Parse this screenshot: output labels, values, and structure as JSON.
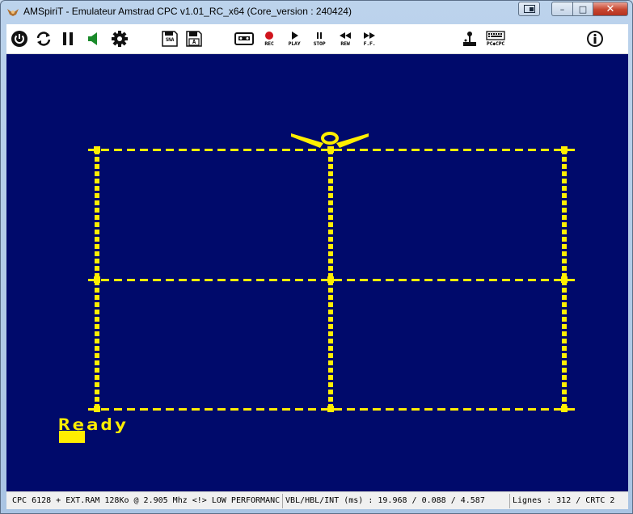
{
  "window": {
    "title": "AMSpiriT - Emulateur Amstrad CPC v1.01_RC_x64 (Core_version : 240424)",
    "controls": {
      "minimize": "–",
      "maximize": "□",
      "close": "✕"
    }
  },
  "toolbar": {
    "items": [
      {
        "name": "power-icon",
        "label": ""
      },
      {
        "name": "reset-icon",
        "label": ""
      },
      {
        "name": "pause-icon",
        "label": ""
      },
      {
        "name": "sound-icon",
        "label": ""
      },
      {
        "name": "settings-gear-icon",
        "label": ""
      },
      {
        "name": "snapshot-icon",
        "label": "SNA"
      },
      {
        "name": "floppy-disk-a-icon",
        "label": "A"
      },
      {
        "name": "cassette-icon",
        "label": ""
      },
      {
        "name": "record-icon",
        "label": "REC"
      },
      {
        "name": "play-icon",
        "label": "PLAY"
      },
      {
        "name": "stop-icon",
        "label": "STOP"
      },
      {
        "name": "rewind-icon",
        "label": "REW"
      },
      {
        "name": "fast-forward-icon",
        "label": "F.F."
      },
      {
        "name": "joystick-icon",
        "label": ""
      },
      {
        "name": "keyboard-pc-cpc-icon",
        "label": "PC◆CPC"
      },
      {
        "name": "info-icon",
        "label": ""
      }
    ]
  },
  "screen": {
    "ready_text": "Ready",
    "colors": {
      "background": "#000a6b",
      "ink": "#ffee00"
    }
  },
  "status": {
    "machine": "CPC 6128 + EXT.RAM 128Ko @ 2.905 Mhz <!> LOW PERFORMANC",
    "timing": "VBL/HBL/INT (ms) : 19.968 / 0.088 / 4.587",
    "crtc": "Lignes : 312 / CRTC 2"
  }
}
